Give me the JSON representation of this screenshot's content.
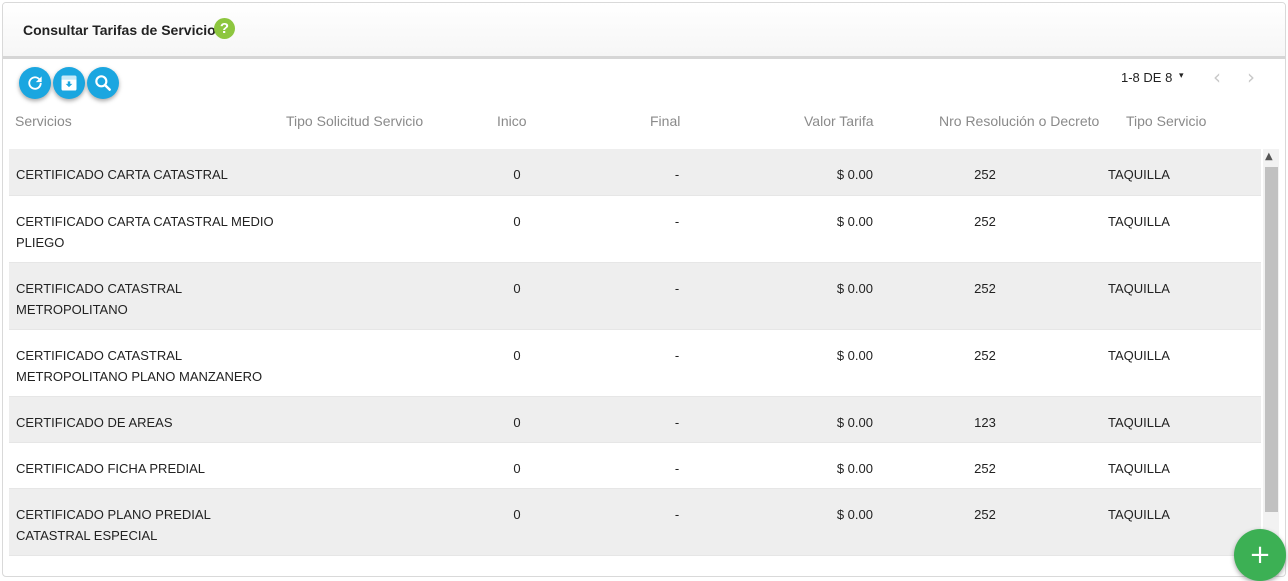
{
  "page": {
    "title": "Consultar Tarifas de Servicios",
    "help_glyph": "?"
  },
  "toolbar": {
    "buttons": [
      {
        "icon": "refresh-icon"
      },
      {
        "icon": "archive-icon"
      },
      {
        "icon": "search-icon"
      }
    ]
  },
  "pager": {
    "range": "1-8 DE 8",
    "caret": "▾",
    "prev": "‹",
    "next": "›"
  },
  "columns": {
    "servicios": "Servicios",
    "tipo_solicitud": "Tipo Solicitud Servicio",
    "inicio": "Inico",
    "final": "Final",
    "valor": "Valor Tarifa",
    "nro": "Nro Resolución o Decreto",
    "tipo_servicio": "Tipo Servicio"
  },
  "rows": [
    {
      "servicio": "CERTIFICADO CARTA CATASTRAL",
      "inicio": "0",
      "final": "-",
      "valor": "$ 0.00",
      "nro": "252",
      "tipo": "TAQUILLA"
    },
    {
      "servicio": "CERTIFICADO CARTA CATASTRAL MEDIO PLIEGO",
      "inicio": "0",
      "final": "-",
      "valor": "$ 0.00",
      "nro": "252",
      "tipo": "TAQUILLA"
    },
    {
      "servicio": "CERTIFICADO CATASTRAL METROPOLITANO",
      "inicio": "0",
      "final": "-",
      "valor": "$ 0.00",
      "nro": "252",
      "tipo": "TAQUILLA"
    },
    {
      "servicio": "CERTIFICADO CATASTRAL METROPOLITANO PLANO MANZANERO",
      "inicio": "0",
      "final": "-",
      "valor": "$ 0.00",
      "nro": "252",
      "tipo": "TAQUILLA"
    },
    {
      "servicio": "CERTIFICADO DE AREAS",
      "inicio": "0",
      "final": "-",
      "valor": "$ 0.00",
      "nro": "123",
      "tipo": "TAQUILLA"
    },
    {
      "servicio": "CERTIFICADO FICHA PREDIAL",
      "inicio": "0",
      "final": "-",
      "valor": "$ 0.00",
      "nro": "252",
      "tipo": "TAQUILLA"
    },
    {
      "servicio": "CERTIFICADO PLANO PREDIAL CATASTRAL ESPECIAL",
      "inicio": "0",
      "final": "-",
      "valor": "$ 0.00",
      "nro": "252",
      "tipo": "TAQUILLA"
    }
  ],
  "fab": {
    "label": "+"
  },
  "colors": {
    "accent": "#1aa6e0",
    "fab": "#3cb054",
    "help": "#8dc63f",
    "row_alt": "#eeeeee"
  }
}
